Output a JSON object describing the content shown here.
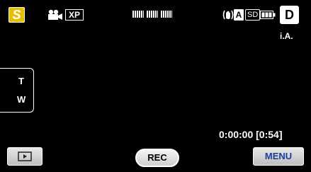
{
  "top_left": {
    "mode_label": "S",
    "mode_color": "#e6c000",
    "movie_icon": "movie-camera-icon",
    "quality_label": "XP"
  },
  "top_right": {
    "stabilizer_icon": "image-stabilizer-icon",
    "auto_label": "A",
    "media_label": "SD",
    "battery_icon": "battery-icon",
    "display_button_label": "D",
    "shooting_mode_label": "i.A."
  },
  "zoom": {
    "tele_label": "T",
    "wide_label": "W"
  },
  "status": {
    "time_display": "0:00:00  [0:54]"
  },
  "bottom": {
    "playback_icon": "play-icon",
    "rec_label": "REC",
    "menu_label": "MENU",
    "menu_color": "#1a3fa0"
  }
}
